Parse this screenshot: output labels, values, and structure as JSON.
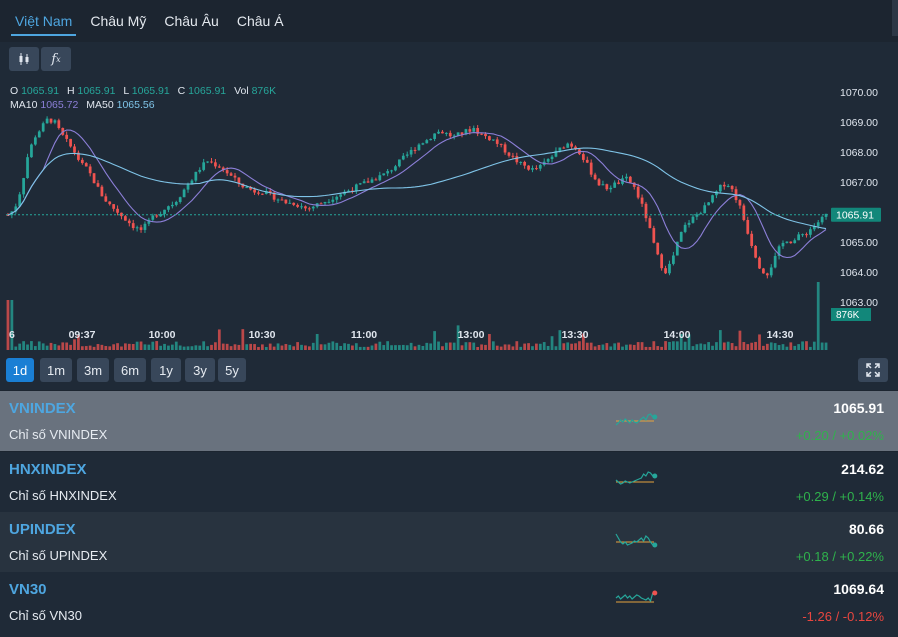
{
  "tabs": [
    {
      "label": "Việt Nam",
      "active": true
    },
    {
      "label": "Châu Mỹ",
      "active": false
    },
    {
      "label": "Châu Âu",
      "active": false
    },
    {
      "label": "Châu Á",
      "active": false
    }
  ],
  "toolbar": {
    "candles_icon": "candlestick-icon",
    "fx_label": "f",
    "fx_sub": "x",
    "settings_icon": "gear-icon"
  },
  "legend": {
    "o_label": "O",
    "o": "1065.91",
    "h_label": "H",
    "h": "1065.91",
    "l_label": "L",
    "l": "1065.91",
    "c_label": "C",
    "c": "1065.91",
    "vol_label": "Vol",
    "vol": "876K",
    "ma10_label": "MA10",
    "ma10": "1065.72",
    "ma50_label": "MA50",
    "ma50": "1065.56"
  },
  "price_axis": [
    "1070.00",
    "1069.00",
    "1068.00",
    "1067.00",
    "1065.00",
    "1064.00",
    "1063.00"
  ],
  "last_price_tag": "1065.91",
  "volume_tag": "876K",
  "time_axis": [
    "6",
    "09:37",
    "10:00",
    "10:30",
    "11:00",
    "13:00",
    "13:30",
    "14:00",
    "14:30"
  ],
  "ranges": [
    {
      "label": "1d",
      "active": true
    },
    {
      "label": "1m",
      "active": false
    },
    {
      "label": "3m",
      "active": false
    },
    {
      "label": "6m",
      "active": false
    },
    {
      "label": "1y",
      "active": false
    },
    {
      "label": "3y",
      "active": false
    },
    {
      "label": "5y",
      "active": false
    }
  ],
  "indices": [
    {
      "symbol": "VNINDEX",
      "name": "Chỉ số VNINDEX",
      "price": "1065.91",
      "change": "+0.20 / +0.02%",
      "direction": "up",
      "selected": true
    },
    {
      "symbol": "HNXINDEX",
      "name": "Chỉ số HNXINDEX",
      "price": "214.62",
      "change": "+0.29 / +0.14%",
      "direction": "up",
      "selected": false
    },
    {
      "symbol": "UPINDEX",
      "name": "Chỉ số UPINDEX",
      "price": "80.66",
      "change": "+0.18 / +0.22%",
      "direction": "up",
      "selected": false
    },
    {
      "symbol": "VN30",
      "name": "Chỉ số VN30",
      "price": "1069.64",
      "change": "-1.26 / -0.12%",
      "direction": "down",
      "selected": false
    }
  ],
  "colors": {
    "up": "#26a69a",
    "down": "#ef5350",
    "ma10": "#8c7fd8",
    "ma50": "#7fc4e8",
    "accent": "#4ea6e0",
    "change_up": "#2fb24c",
    "change_down": "#e8463f"
  },
  "chart_data": {
    "type": "candlestick",
    "y_range": [
      1062.5,
      1070.5
    ],
    "intraday_path": [
      1065.9,
      1066.1,
      1066.8,
      1067.9,
      1068.5,
      1068.8,
      1069.1,
      1069.0,
      1068.6,
      1068.3,
      1068.0,
      1067.6,
      1067.4,
      1067.0,
      1066.6,
      1066.3,
      1066.1,
      1065.9,
      1065.7,
      1065.5,
      1065.4,
      1065.6,
      1065.9,
      1066.0,
      1066.2,
      1066.3,
      1066.6,
      1066.9,
      1067.2,
      1067.5,
      1067.7,
      1067.6,
      1067.5,
      1067.3,
      1067.1,
      1066.9,
      1066.8,
      1066.7,
      1066.7,
      1066.6,
      1066.5,
      1066.4,
      1066.3,
      1066.3,
      1066.2,
      1066.1,
      1066.2,
      1066.3,
      1066.4,
      1066.5,
      1066.6,
      1066.7,
      1066.8,
      1066.9,
      1067.0,
      1067.1,
      1067.2,
      1067.3,
      1067.5,
      1067.7,
      1067.9,
      1068.1,
      1068.3,
      1068.4,
      1068.6,
      1068.7,
      1068.6,
      1068.5,
      1068.6,
      1068.7,
      1068.8,
      1068.6,
      1068.5,
      1068.4,
      1068.2,
      1068.0,
      1067.8,
      1067.6,
      1067.5,
      1067.4,
      1067.5,
      1067.7,
      1067.9,
      1068.1,
      1068.3,
      1068.2,
      1068.0,
      1067.6,
      1067.2,
      1066.9,
      1066.8,
      1066.9,
      1067.0,
      1067.1,
      1066.9,
      1066.4,
      1065.8,
      1065.0,
      1064.3,
      1064.0,
      1064.5,
      1065.2,
      1065.6,
      1065.8,
      1066.0,
      1066.2,
      1066.5,
      1066.8,
      1067.0,
      1066.7,
      1066.2,
      1065.5,
      1064.8,
      1064.2,
      1063.9,
      1064.3,
      1064.8,
      1065.1,
      1065.0,
      1065.2,
      1065.3,
      1065.5,
      1065.7,
      1065.9
    ]
  }
}
